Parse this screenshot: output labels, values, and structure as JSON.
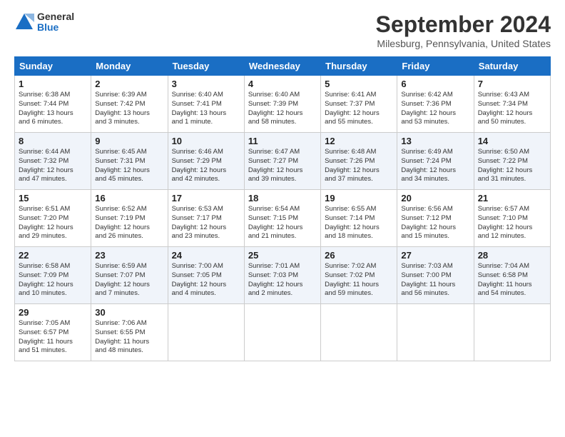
{
  "logo": {
    "general": "General",
    "blue": "Blue"
  },
  "title": "September 2024",
  "location": "Milesburg, Pennsylvania, United States",
  "days_of_week": [
    "Sunday",
    "Monday",
    "Tuesday",
    "Wednesday",
    "Thursday",
    "Friday",
    "Saturday"
  ],
  "weeks": [
    [
      {
        "day": "1",
        "info": "Sunrise: 6:38 AM\nSunset: 7:44 PM\nDaylight: 13 hours\nand 6 minutes."
      },
      {
        "day": "2",
        "info": "Sunrise: 6:39 AM\nSunset: 7:42 PM\nDaylight: 13 hours\nand 3 minutes."
      },
      {
        "day": "3",
        "info": "Sunrise: 6:40 AM\nSunset: 7:41 PM\nDaylight: 13 hours\nand 1 minute."
      },
      {
        "day": "4",
        "info": "Sunrise: 6:40 AM\nSunset: 7:39 PM\nDaylight: 12 hours\nand 58 minutes."
      },
      {
        "day": "5",
        "info": "Sunrise: 6:41 AM\nSunset: 7:37 PM\nDaylight: 12 hours\nand 55 minutes."
      },
      {
        "day": "6",
        "info": "Sunrise: 6:42 AM\nSunset: 7:36 PM\nDaylight: 12 hours\nand 53 minutes."
      },
      {
        "day": "7",
        "info": "Sunrise: 6:43 AM\nSunset: 7:34 PM\nDaylight: 12 hours\nand 50 minutes."
      }
    ],
    [
      {
        "day": "8",
        "info": "Sunrise: 6:44 AM\nSunset: 7:32 PM\nDaylight: 12 hours\nand 47 minutes."
      },
      {
        "day": "9",
        "info": "Sunrise: 6:45 AM\nSunset: 7:31 PM\nDaylight: 12 hours\nand 45 minutes."
      },
      {
        "day": "10",
        "info": "Sunrise: 6:46 AM\nSunset: 7:29 PM\nDaylight: 12 hours\nand 42 minutes."
      },
      {
        "day": "11",
        "info": "Sunrise: 6:47 AM\nSunset: 7:27 PM\nDaylight: 12 hours\nand 39 minutes."
      },
      {
        "day": "12",
        "info": "Sunrise: 6:48 AM\nSunset: 7:26 PM\nDaylight: 12 hours\nand 37 minutes."
      },
      {
        "day": "13",
        "info": "Sunrise: 6:49 AM\nSunset: 7:24 PM\nDaylight: 12 hours\nand 34 minutes."
      },
      {
        "day": "14",
        "info": "Sunrise: 6:50 AM\nSunset: 7:22 PM\nDaylight: 12 hours\nand 31 minutes."
      }
    ],
    [
      {
        "day": "15",
        "info": "Sunrise: 6:51 AM\nSunset: 7:20 PM\nDaylight: 12 hours\nand 29 minutes."
      },
      {
        "day": "16",
        "info": "Sunrise: 6:52 AM\nSunset: 7:19 PM\nDaylight: 12 hours\nand 26 minutes."
      },
      {
        "day": "17",
        "info": "Sunrise: 6:53 AM\nSunset: 7:17 PM\nDaylight: 12 hours\nand 23 minutes."
      },
      {
        "day": "18",
        "info": "Sunrise: 6:54 AM\nSunset: 7:15 PM\nDaylight: 12 hours\nand 21 minutes."
      },
      {
        "day": "19",
        "info": "Sunrise: 6:55 AM\nSunset: 7:14 PM\nDaylight: 12 hours\nand 18 minutes."
      },
      {
        "day": "20",
        "info": "Sunrise: 6:56 AM\nSunset: 7:12 PM\nDaylight: 12 hours\nand 15 minutes."
      },
      {
        "day": "21",
        "info": "Sunrise: 6:57 AM\nSunset: 7:10 PM\nDaylight: 12 hours\nand 12 minutes."
      }
    ],
    [
      {
        "day": "22",
        "info": "Sunrise: 6:58 AM\nSunset: 7:09 PM\nDaylight: 12 hours\nand 10 minutes."
      },
      {
        "day": "23",
        "info": "Sunrise: 6:59 AM\nSunset: 7:07 PM\nDaylight: 12 hours\nand 7 minutes."
      },
      {
        "day": "24",
        "info": "Sunrise: 7:00 AM\nSunset: 7:05 PM\nDaylight: 12 hours\nand 4 minutes."
      },
      {
        "day": "25",
        "info": "Sunrise: 7:01 AM\nSunset: 7:03 PM\nDaylight: 12 hours\nand 2 minutes."
      },
      {
        "day": "26",
        "info": "Sunrise: 7:02 AM\nSunset: 7:02 PM\nDaylight: 11 hours\nand 59 minutes."
      },
      {
        "day": "27",
        "info": "Sunrise: 7:03 AM\nSunset: 7:00 PM\nDaylight: 11 hours\nand 56 minutes."
      },
      {
        "day": "28",
        "info": "Sunrise: 7:04 AM\nSunset: 6:58 PM\nDaylight: 11 hours\nand 54 minutes."
      }
    ],
    [
      {
        "day": "29",
        "info": "Sunrise: 7:05 AM\nSunset: 6:57 PM\nDaylight: 11 hours\nand 51 minutes."
      },
      {
        "day": "30",
        "info": "Sunrise: 7:06 AM\nSunset: 6:55 PM\nDaylight: 11 hours\nand 48 minutes."
      },
      null,
      null,
      null,
      null,
      null
    ]
  ]
}
